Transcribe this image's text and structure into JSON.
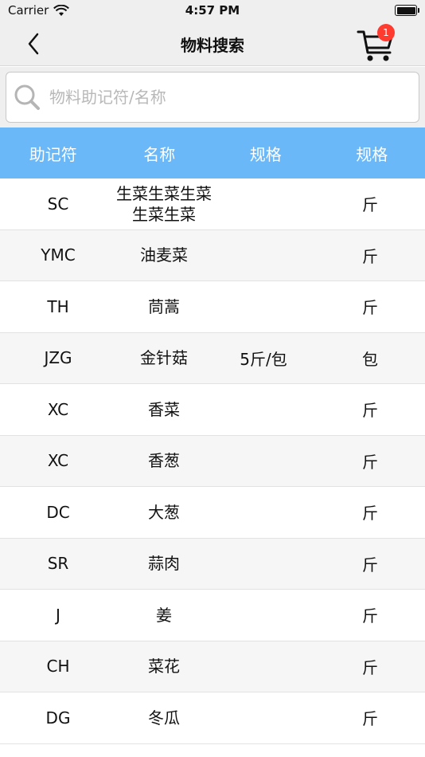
{
  "status": {
    "carrier": "Carrier",
    "time": "4:57 PM"
  },
  "nav": {
    "title": "物料搜索",
    "cart_count": "1"
  },
  "search": {
    "placeholder": "物料助记符/名称"
  },
  "table": {
    "headers": [
      "助记符",
      "名称",
      "规格",
      "规格"
    ],
    "rows": [
      {
        "code": "SC",
        "name": "生菜生菜生菜生菜生菜",
        "spec": "",
        "unit": "斤"
      },
      {
        "code": "YMC",
        "name": "油麦菜",
        "spec": "",
        "unit": "斤"
      },
      {
        "code": "TH",
        "name": "茼蒿",
        "spec": "",
        "unit": "斤"
      },
      {
        "code": "JZG",
        "name": "金针菇",
        "spec": "5斤/包",
        "unit": "包"
      },
      {
        "code": "XC",
        "name": "香菜",
        "spec": "",
        "unit": "斤"
      },
      {
        "code": "XC",
        "name": "香葱",
        "spec": "",
        "unit": "斤"
      },
      {
        "code": "DC",
        "name": "大葱",
        "spec": "",
        "unit": "斤"
      },
      {
        "code": "SR",
        "name": "蒜肉",
        "spec": "",
        "unit": "斤"
      },
      {
        "code": "J",
        "name": "姜",
        "spec": "",
        "unit": "斤"
      },
      {
        "code": "CH",
        "name": "菜花",
        "spec": "",
        "unit": "斤"
      },
      {
        "code": "DG",
        "name": "冬瓜",
        "spec": "",
        "unit": "斤"
      }
    ]
  }
}
